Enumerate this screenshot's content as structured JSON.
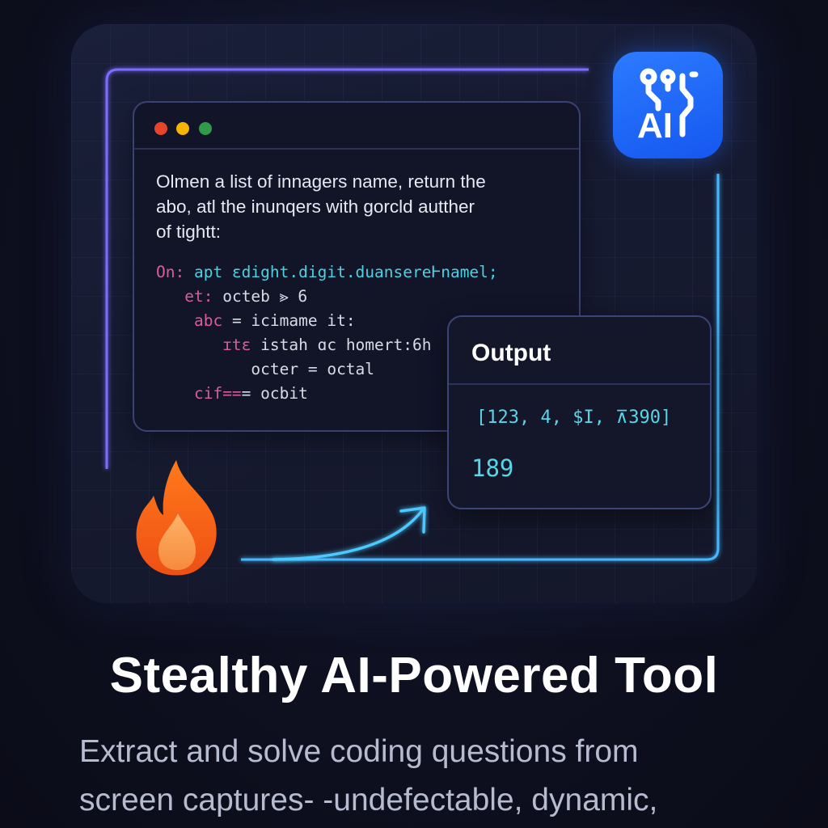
{
  "window_dots": [
    "close",
    "minimize",
    "maximize"
  ],
  "prompt": {
    "line1": "Olmen a list of innagers name, return the",
    "line2": "abo, atl the inunqers with gorcld autther",
    "line3": "of tightt:"
  },
  "code": {
    "l1_kw": "On:",
    "l1_text": " apt ɛdight.digit.duansereⱵnamel;",
    "l2_kw": "et:",
    "l2_text": " octeb ⪢ 6",
    "l3_kw": "abc",
    "l3_text": " = icimame it:",
    "l4_kw": "ɪtɛ",
    "l4_text": " istah ɑc homert:6h",
    "l5_text": "octer = octal",
    "l6_kw": "cif==",
    "l6_text": "= ocbit"
  },
  "output": {
    "title": "Output",
    "array": "[123, 4, $I, ⊼390]",
    "value": "189"
  },
  "logo": {
    "text": "AI",
    "name": "ai-logo-icon"
  },
  "flame": {
    "name": "flame-icon"
  },
  "headline": "Stealthy AI-Powered Tool",
  "description": {
    "line1": "Extract and solve coding questions from",
    "line2": "screen captures- -undefectable, dynamic,"
  },
  "colors": {
    "accent_cyan": "#58d5e6",
    "accent_pink": "#d85d9a",
    "brand_blue": "#1557f0",
    "flame_orange": "#f06a1c"
  }
}
